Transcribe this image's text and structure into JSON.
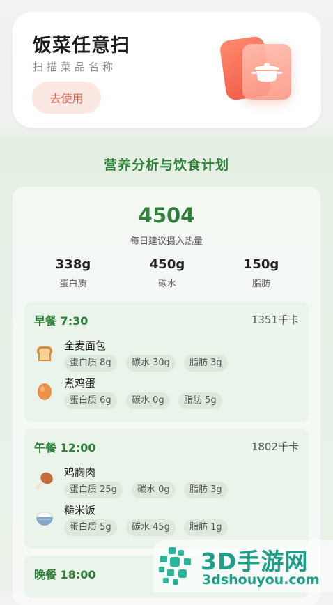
{
  "scan": {
    "title": "饭菜任意扫",
    "subtitle": "扫描菜品名称",
    "button": "去使用"
  },
  "section_title": "营养分析与饮食计划",
  "summary": {
    "kcal": "4504",
    "kcal_label": "每日建议摄入热量",
    "macros": [
      {
        "value": "338g",
        "label": "蛋白质"
      },
      {
        "value": "450g",
        "label": "碳水"
      },
      {
        "value": "150g",
        "label": "脂肪"
      }
    ]
  },
  "meals": [
    {
      "title": "早餐 7:30",
      "kcal": "1351千卡",
      "foods": [
        {
          "icon": "bread-icon",
          "name": "全麦面包",
          "tags": [
            "蛋白质 8g",
            "碳水 30g",
            "脂肪 3g"
          ]
        },
        {
          "icon": "egg-icon",
          "name": "煮鸡蛋",
          "tags": [
            "蛋白质 6g",
            "碳水 0g",
            "脂肪 5g"
          ]
        }
      ]
    },
    {
      "title": "午餐 12:00",
      "kcal": "1802千卡",
      "foods": [
        {
          "icon": "chicken-leg-icon",
          "name": "鸡胸肉",
          "tags": [
            "蛋白质 25g",
            "碳水 0g",
            "脂肪 3g"
          ]
        },
        {
          "icon": "rice-bowl-icon",
          "name": "糙米饭",
          "tags": [
            "蛋白质 5g",
            "碳水 45g",
            "脂肪 1g"
          ]
        }
      ]
    },
    {
      "title": "晚餐 18:00"
    }
  ],
  "watermark": {
    "text": "3D手游网",
    "url": "3dshouyou.com"
  },
  "colors": {
    "accent_green": "#2f7f3b",
    "button_bg": "#fbe8e3",
    "button_text": "#d9674f",
    "pot_red": "#ef5a46"
  }
}
